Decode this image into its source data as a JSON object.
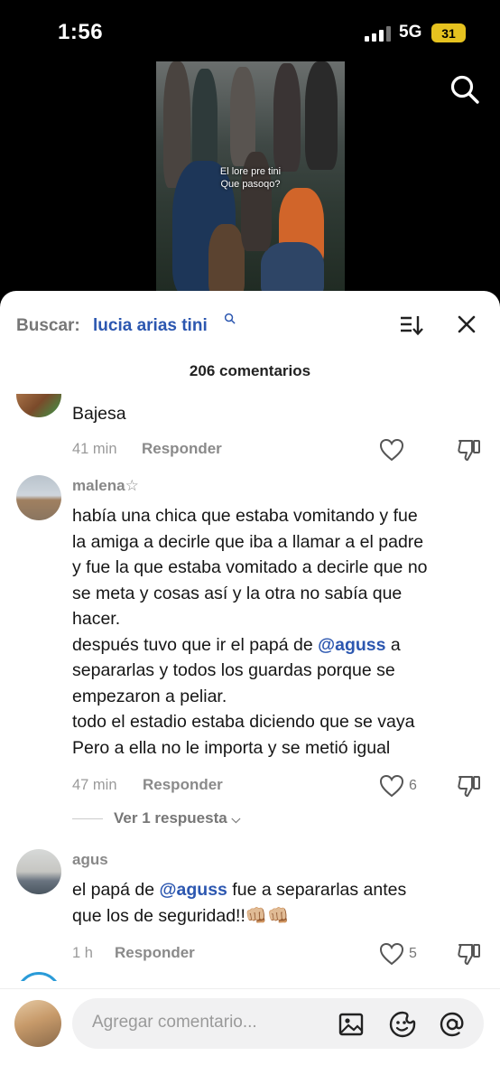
{
  "status": {
    "time": "1:56",
    "network": "5G",
    "battery": "31"
  },
  "video": {
    "caption_line1": "El lore pre tini",
    "caption_line2": "Que pasoqo?"
  },
  "search": {
    "label": "Buscar:",
    "query": "lucia arias tini"
  },
  "comments_header": {
    "count_text": "206 comentarios"
  },
  "comments": [
    {
      "username": "",
      "text": "Bajesa",
      "time": "41 min",
      "reply_label": "Responder",
      "likes": ""
    },
    {
      "username": "malena☆",
      "text_lines": [
        "había una chica que estaba vomitando y fue",
        "la amiga a decirle que iba a llamar a el padre",
        "y fue la que estaba vomitado a decirle que no",
        "se meta y cosas así y la otra no sabía que",
        "hacer."
      ],
      "text2_prefix": "después tuvo que ir el papá de ",
      "text2_mention": "@aguss",
      "text2_suffix": " a",
      "text2_lines": [
        "separarlas y todos los guardas porque se",
        "empezaron a peliar.",
        "todo el estadio estaba diciendo que se vaya",
        "Pero a ella no le importa y se metió igual"
      ],
      "time": "47 min",
      "reply_label": "Responder",
      "likes": "6",
      "view_replies": "Ver 1 respuesta"
    },
    {
      "username": "agus",
      "text_prefix": "el papá de ",
      "text_mention": "@aguss",
      "text_suffix": " fue a separarlas antes",
      "text_line2": "que los de seguridad!!👊🏼👊🏼",
      "time": "1 h",
      "reply_label": "Responder",
      "likes": "5"
    }
  ],
  "input": {
    "placeholder": "Agregar comentario..."
  },
  "icons": {
    "search": "search-icon",
    "sort": "sort-icon",
    "close": "close-icon",
    "heart": "heart-icon",
    "dislike": "dislike-icon",
    "image": "image-icon",
    "emoji": "emoji-icon",
    "mention": "at-icon"
  },
  "colors": {
    "accent": "#2c57b0",
    "battery": "#e6c21f"
  }
}
